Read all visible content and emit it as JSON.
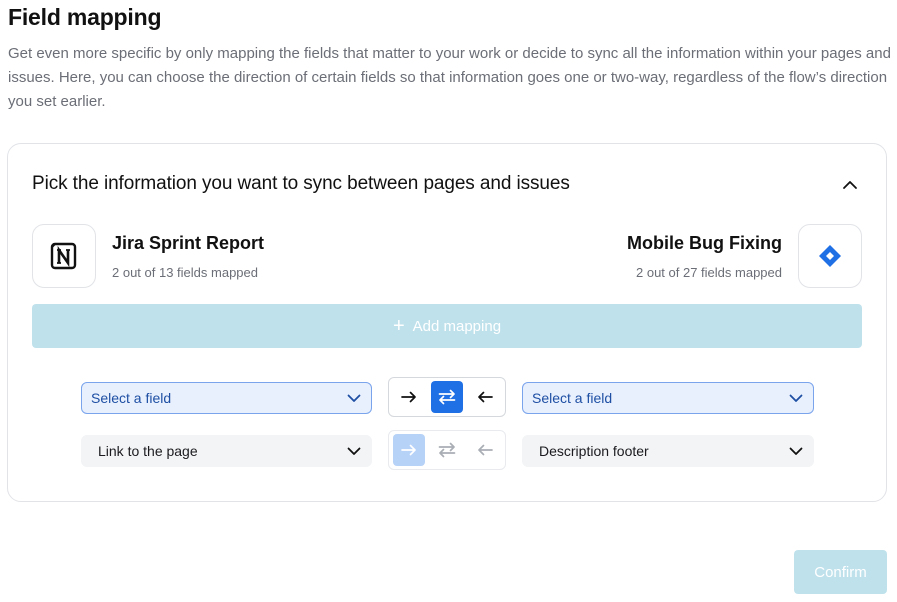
{
  "page": {
    "title": "Field mapping",
    "description": "Get even more specific by only mapping the fields that matter to your work or decide to sync all the information within your pages and issues. Here, you can choose the direction of certain fields so that information goes one or two-way, regardless of the flow’s direction you set earlier."
  },
  "card": {
    "heading": "Pick the information you want to sync between pages and issues",
    "collapse_icon": "chevron-up-icon",
    "source": {
      "name": "Jira Sprint Report",
      "fields_mapped": "2 out of 13 fields mapped",
      "icon": "notion-logo-icon"
    },
    "destination": {
      "name": "Mobile Bug Fixing",
      "fields_mapped": "2 out of 27 fields mapped",
      "icon": "jira-logo-icon"
    },
    "add_mapping_label": "Add mapping"
  },
  "mappings": [
    {
      "left_value": "Select a field",
      "right_value": "Select a field",
      "direction": "two-way",
      "state": "editing"
    },
    {
      "left_value": "Link to the page",
      "right_value": "Description footer",
      "direction": "left-to-right",
      "state": "saved"
    }
  ],
  "confirm_label": "Confirm",
  "colors": {
    "accent": "#1f6fe5",
    "accent_faded": "#b6d2f7",
    "button_disabled": "#bfe1ec",
    "select_active_bg": "#e8f0fe",
    "jira_blue": "#2684ff"
  }
}
